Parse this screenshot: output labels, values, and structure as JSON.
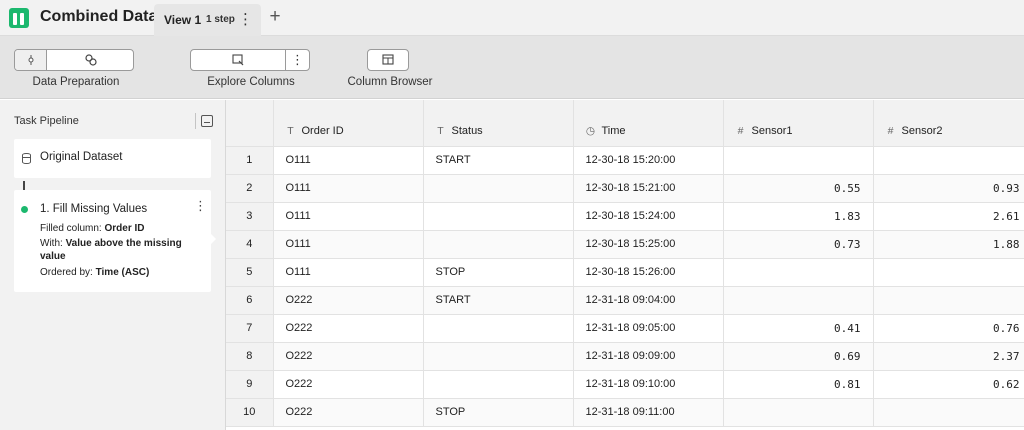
{
  "app": {
    "title": "Combined Data"
  },
  "tabs": [
    {
      "label": "View 1",
      "badge": "1 step"
    }
  ],
  "toolbar": {
    "data_preparation_label": "Data Preparation",
    "explore_columns_label": "Explore Columns",
    "column_browser_label": "Column Browser"
  },
  "sidebar": {
    "title": "Task Pipeline",
    "original_dataset": "Original Dataset",
    "step": {
      "title": "1. Fill Missing Values",
      "filled_label": "Filled column:",
      "filled_value": "Order ID",
      "with_label": "With:",
      "with_value": "Value above the missing value",
      "ordered_label": "Ordered by:",
      "ordered_value": "Time (ASC)"
    }
  },
  "table": {
    "columns": [
      {
        "name": "Order ID",
        "type_icon": "text-type-icon"
      },
      {
        "name": "Status",
        "type_icon": "text-type-icon"
      },
      {
        "name": "Time",
        "type_icon": "clock-type-icon"
      },
      {
        "name": "Sensor1",
        "type_icon": "number-type-icon"
      },
      {
        "name": "Sensor2",
        "type_icon": "number-type-icon"
      }
    ],
    "rows": [
      [
        "1",
        "O111",
        "START",
        "12-30-18 15:20:00",
        "",
        ""
      ],
      [
        "2",
        "O111",
        "",
        "12-30-18 15:21:00",
        "0.55",
        "0.93"
      ],
      [
        "3",
        "O111",
        "",
        "12-30-18 15:24:00",
        "1.83",
        "2.61"
      ],
      [
        "4",
        "O111",
        "",
        "12-30-18 15:25:00",
        "0.73",
        "1.88"
      ],
      [
        "5",
        "O111",
        "STOP",
        "12-30-18 15:26:00",
        "",
        ""
      ],
      [
        "6",
        "O222",
        "START",
        "12-31-18 09:04:00",
        "",
        ""
      ],
      [
        "7",
        "O222",
        "",
        "12-31-18 09:05:00",
        "0.41",
        "0.76"
      ],
      [
        "8",
        "O222",
        "",
        "12-31-18 09:09:00",
        "0.69",
        "2.37"
      ],
      [
        "9",
        "O222",
        "",
        "12-31-18 09:10:00",
        "0.81",
        "0.62"
      ],
      [
        "10",
        "O222",
        "STOP",
        "12-31-18 09:11:00",
        "",
        ""
      ]
    ]
  },
  "colors": {
    "accent": "#1cb86e"
  }
}
